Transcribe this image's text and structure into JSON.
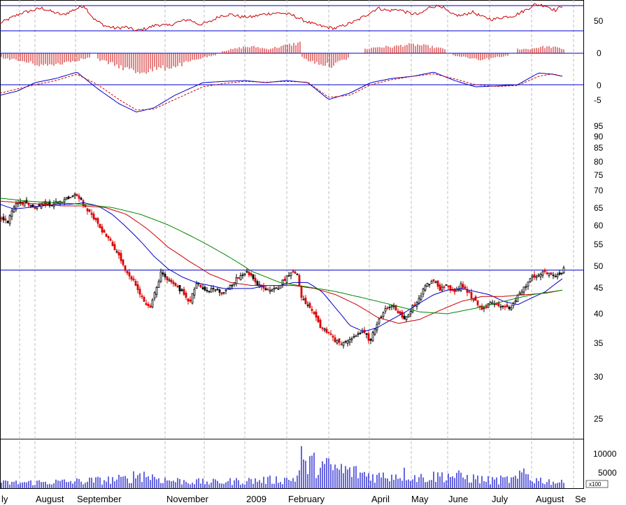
{
  "chart_data": [
    {
      "panel": "rsi",
      "type": "line",
      "y_ticks": [
        "50"
      ],
      "ylim": [
        15,
        85
      ],
      "reference_lines": [
        70,
        30
      ],
      "series": [
        {
          "color": "#cc0000",
          "x": [
            0,
            15,
            30,
            45,
            60,
            75,
            90,
            105,
            120,
            135,
            150,
            165,
            180,
            195,
            210,
            225,
            240,
            255,
            270,
            285,
            300,
            315,
            330,
            345,
            360,
            375,
            390,
            405,
            420,
            435,
            450,
            465,
            480,
            495,
            510,
            525,
            540,
            555,
            570,
            585,
            600,
            615,
            630,
            645,
            660,
            675,
            690,
            705,
            720,
            735,
            750,
            765,
            780,
            795,
            803
          ],
          "values": [
            42,
            50,
            58,
            62,
            66,
            60,
            55,
            63,
            70,
            48,
            38,
            34,
            36,
            30,
            34,
            40,
            38,
            44,
            48,
            40,
            44,
            54,
            56,
            52,
            52,
            56,
            58,
            58,
            54,
            46,
            40,
            36,
            34,
            40,
            46,
            56,
            66,
            62,
            64,
            58,
            56,
            68,
            70,
            56,
            54,
            60,
            52,
            48,
            52,
            54,
            62,
            72,
            70,
            62,
            70
          ]
        }
      ]
    },
    {
      "panel": "momentum-histogram",
      "type": "bar",
      "y_ticks": [
        "0"
      ],
      "ylim": [
        -10,
        6
      ],
      "color": "#cc0000",
      "groups": [
        {
          "x_from": 2,
          "x_to": 130,
          "values": [
            -2,
            -3,
            -4,
            -5,
            -6,
            -5,
            -4,
            -3,
            -2
          ]
        },
        {
          "x_from": 140,
          "x_to": 310,
          "values": [
            -3,
            -5,
            -7,
            -9,
            -8,
            -7,
            -6,
            -4,
            -2,
            -1
          ]
        },
        {
          "x_from": 318,
          "x_to": 430,
          "values": [
            1,
            2,
            3,
            3,
            2,
            3,
            4,
            5
          ]
        },
        {
          "x_from": 432,
          "x_to": 500,
          "values": [
            -2,
            -4,
            -5,
            -6,
            -4,
            -2
          ]
        },
        {
          "x_from": 522,
          "x_to": 636,
          "values": [
            2,
            3,
            3,
            4,
            4,
            3,
            2
          ]
        },
        {
          "x_from": 648,
          "x_to": 728,
          "values": [
            -1,
            -2,
            -3,
            -2,
            -1
          ]
        },
        {
          "x_from": 740,
          "x_to": 806,
          "values": [
            2,
            2,
            3,
            3,
            2
          ]
        }
      ]
    },
    {
      "panel": "oscillator",
      "type": "line",
      "y_ticks": [
        "0",
        "-5"
      ],
      "ylim": [
        -10,
        7
      ],
      "series": [
        {
          "color": "#0000cc",
          "x": [
            0,
            25,
            50,
            80,
            110,
            140,
            170,
            195,
            220,
            250,
            290,
            320,
            350,
            380,
            410,
            440,
            470,
            500,
            530,
            560,
            590,
            620,
            650,
            680,
            710,
            740,
            770,
            790,
            805
          ],
          "values": [
            -2.5,
            -1.5,
            0.5,
            1.5,
            3,
            -1,
            -4.5,
            -6.5,
            -5.5,
            -2.5,
            0.5,
            0.8,
            1,
            0.5,
            1,
            0.5,
            -3.5,
            -2,
            0.5,
            1.5,
            2,
            3,
            1,
            -0.5,
            -0.3,
            0,
            2.8,
            2.5,
            2
          ]
        },
        {
          "color": "#cc0000",
          "style": "dashed",
          "x": [
            0,
            25,
            50,
            80,
            110,
            140,
            170,
            195,
            220,
            250,
            290,
            320,
            350,
            380,
            410,
            440,
            470,
            500,
            530,
            560,
            590,
            620,
            650,
            680,
            710,
            740,
            770,
            790,
            805
          ],
          "values": [
            -2,
            -1,
            0,
            1,
            2.5,
            0,
            -3.5,
            -6,
            -5.8,
            -3.5,
            -0.5,
            0.3,
            0.8,
            0.6,
            0.8,
            0.6,
            -3,
            -2.5,
            0,
            1.2,
            2,
            2.6,
            1.4,
            0,
            -0.4,
            -0.2,
            2,
            2.6,
            2
          ]
        }
      ]
    },
    {
      "panel": "price",
      "type": "candlestick",
      "scale": "log",
      "y_ticks": [
        "95",
        "90",
        "85",
        "80",
        "75",
        "70",
        "65",
        "60",
        "55",
        "50",
        "45",
        "40",
        "35",
        "30",
        "25"
      ],
      "ylim": [
        22,
        102
      ],
      "horizontal_line": 48.5,
      "path": {
        "x": [
          0,
          10,
          20,
          35,
          50,
          62,
          72,
          85,
          95,
          105,
          112,
          118,
          126,
          135,
          145,
          155,
          165,
          172,
          180,
          188,
          196,
          205,
          214,
          222,
          230,
          238,
          248,
          258,
          270,
          280,
          292,
          305,
          318,
          330,
          340,
          350,
          358,
          366,
          375,
          385,
          395,
          405,
          415,
          424,
          430,
          438,
          448,
          458,
          468,
          478,
          488,
          498,
          508,
          518,
          528,
          538,
          548,
          558,
          568,
          578,
          588,
          598,
          608,
          618,
          628,
          638,
          648,
          658,
          668,
          678,
          688,
          698,
          708,
          718,
          728,
          738,
          748,
          758,
          768,
          778,
          788,
          798,
          806
        ],
        "y": [
          73,
          71,
          80,
          83,
          78,
          82,
          81,
          83,
          85,
          87,
          86,
          80,
          76,
          72,
          66,
          62,
          56,
          52,
          47,
          45,
          42,
          38,
          36,
          42,
          48,
          45,
          43,
          41,
          38,
          44,
          41,
          42,
          40,
          43,
          46,
          48,
          47,
          44,
          42,
          41,
          42,
          45,
          48,
          47,
          39,
          37,
          34,
          31,
          30,
          28,
          27,
          28,
          29,
          30,
          28,
          32,
          35,
          37,
          35,
          33,
          36,
          39,
          43,
          45,
          42,
          44,
          40,
          43,
          41,
          38,
          36,
          37,
          38,
          36,
          36,
          39,
          42,
          46,
          47,
          48,
          47,
          46,
          50
        ]
      },
      "red_candle_ranges": [
        [
          120,
          230
        ],
        [
          400,
          480
        ],
        [
          600,
          700
        ]
      ],
      "moving_averages": [
        {
          "color": "#0000cc",
          "x": [
            0,
            20,
            40,
            60,
            80,
            100,
            120,
            140,
            160,
            180,
            200,
            220,
            240,
            260,
            280,
            300,
            320,
            340,
            360,
            380,
            400,
            420,
            440,
            460,
            480,
            500,
            520,
            540,
            560,
            580,
            600,
            620,
            640,
            660,
            680,
            700,
            720,
            740,
            760,
            780,
            805
          ],
          "values": [
            81,
            78,
            79,
            80,
            81,
            81,
            82,
            80,
            75,
            68,
            61,
            54,
            49,
            46,
            44,
            43,
            42,
            42,
            42,
            43,
            43,
            44,
            44,
            41,
            36,
            31.5,
            30,
            31,
            33,
            35,
            37.5,
            40,
            41.5,
            42,
            41,
            40,
            38,
            37,
            39,
            41,
            45.5
          ]
        },
        {
          "color": "#cc0000",
          "x": [
            0,
            30,
            60,
            90,
            120,
            150,
            180,
            210,
            240,
            270,
            300,
            330,
            360,
            390,
            420,
            450,
            480,
            510,
            540,
            570,
            600,
            630,
            660,
            690,
            720,
            750,
            780,
            805
          ],
          "values": [
            83,
            82,
            81,
            80,
            80,
            79,
            75,
            67,
            58,
            52,
            47,
            44,
            43,
            43,
            43,
            42,
            40,
            37,
            33.5,
            32,
            33,
            35.5,
            38,
            39.5,
            39.5,
            40,
            40.5,
            41.5
          ]
        },
        {
          "color": "#008800",
          "x": [
            0,
            40,
            80,
            120,
            160,
            200,
            240,
            280,
            320,
            360,
            400,
            440,
            480,
            520,
            560,
            600,
            640,
            680,
            720,
            760,
            805
          ],
          "values": [
            85,
            83,
            82,
            81,
            79,
            75,
            69,
            62,
            55,
            48,
            44,
            42.5,
            41,
            39,
            37,
            35,
            34.5,
            36,
            38,
            40,
            41.5
          ]
        }
      ]
    },
    {
      "panel": "volume",
      "type": "bar",
      "y_ticks": [
        "10000",
        "5000"
      ],
      "unit_label": "x100",
      "ylim": [
        0,
        14000
      ],
      "color": "#0000cc",
      "highlight": {
        "x": 432,
        "value": 13000
      },
      "profile": {
        "x": [
          0,
          100,
          180,
          200,
          240,
          300,
          420,
          440,
          540,
          580,
          600,
          640,
          700,
          740,
          750,
          760,
          806
        ],
        "values": [
          2000,
          2500,
          3500,
          5500,
          3000,
          2300,
          3500,
          9500,
          4500,
          5500,
          4000,
          5000,
          3000,
          3500,
          6500,
          3500,
          2000
        ]
      }
    }
  ],
  "x_axis": {
    "labels": [
      "ly",
      "August",
      "September",
      "November",
      "2009",
      "February",
      "April",
      "May",
      "June",
      "July",
      "August",
      "Se"
    ]
  }
}
